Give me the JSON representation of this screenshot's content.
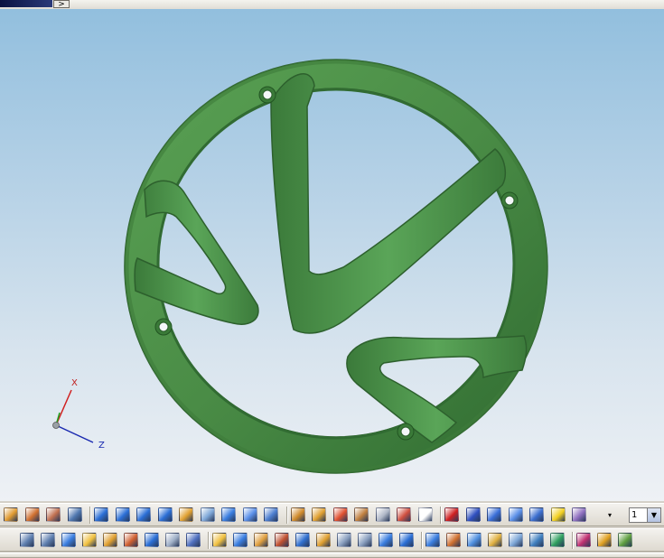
{
  "window": {
    "expand_arrow": ">"
  },
  "viewport": {
    "model_color": "#4a8a45",
    "triad": {
      "x_label": "X",
      "z_label": "Z"
    }
  },
  "toolbar_row1": {
    "icons": [
      "analysis-icon",
      "tools-icon",
      "swirl-icon",
      "measure-icon",
      "solid-icon",
      "solid-icon",
      "solid-icon",
      "solid-icon",
      "surface-icon",
      "view-icon",
      "box-icon",
      "cylinder-icon",
      "shade-icon",
      "move-icon",
      "feature-icon",
      "point-icon",
      "section-icon",
      "rectangle-icon",
      "transform-icon",
      "datum-plane-icon",
      "red-arrow-icon",
      "axis-triad-icon",
      "block-icon",
      "cylinder-icon",
      "cone-icon",
      "sphere-icon",
      "wireframe-icon"
    ],
    "layer_select": {
      "value": "1",
      "arrow": "▼"
    }
  },
  "toolbar_row2": {
    "icons": [
      "layer-icon",
      "layer-icon",
      "box-icon",
      "sheet-icon",
      "surface-icon",
      "text-icon",
      "solid-icon",
      "array-icon",
      "link-icon",
      "sheet-icon",
      "box-icon",
      "hole-icon",
      "cut-icon",
      "chart-icon",
      "pattern-icon",
      "face-icon",
      "face-icon",
      "box-icon",
      "solid-icon",
      "box-icon",
      "tools-icon",
      "shell-icon",
      "flange-icon",
      "view-icon",
      "rotate-icon",
      "render-icon",
      "pen-icon",
      "color-icon",
      "brush-icon"
    ]
  },
  "colors": {
    "toolbar_bg": "#dedad0",
    "viewport_top": "#92bfde",
    "viewport_bottom": "#eef1f5"
  }
}
